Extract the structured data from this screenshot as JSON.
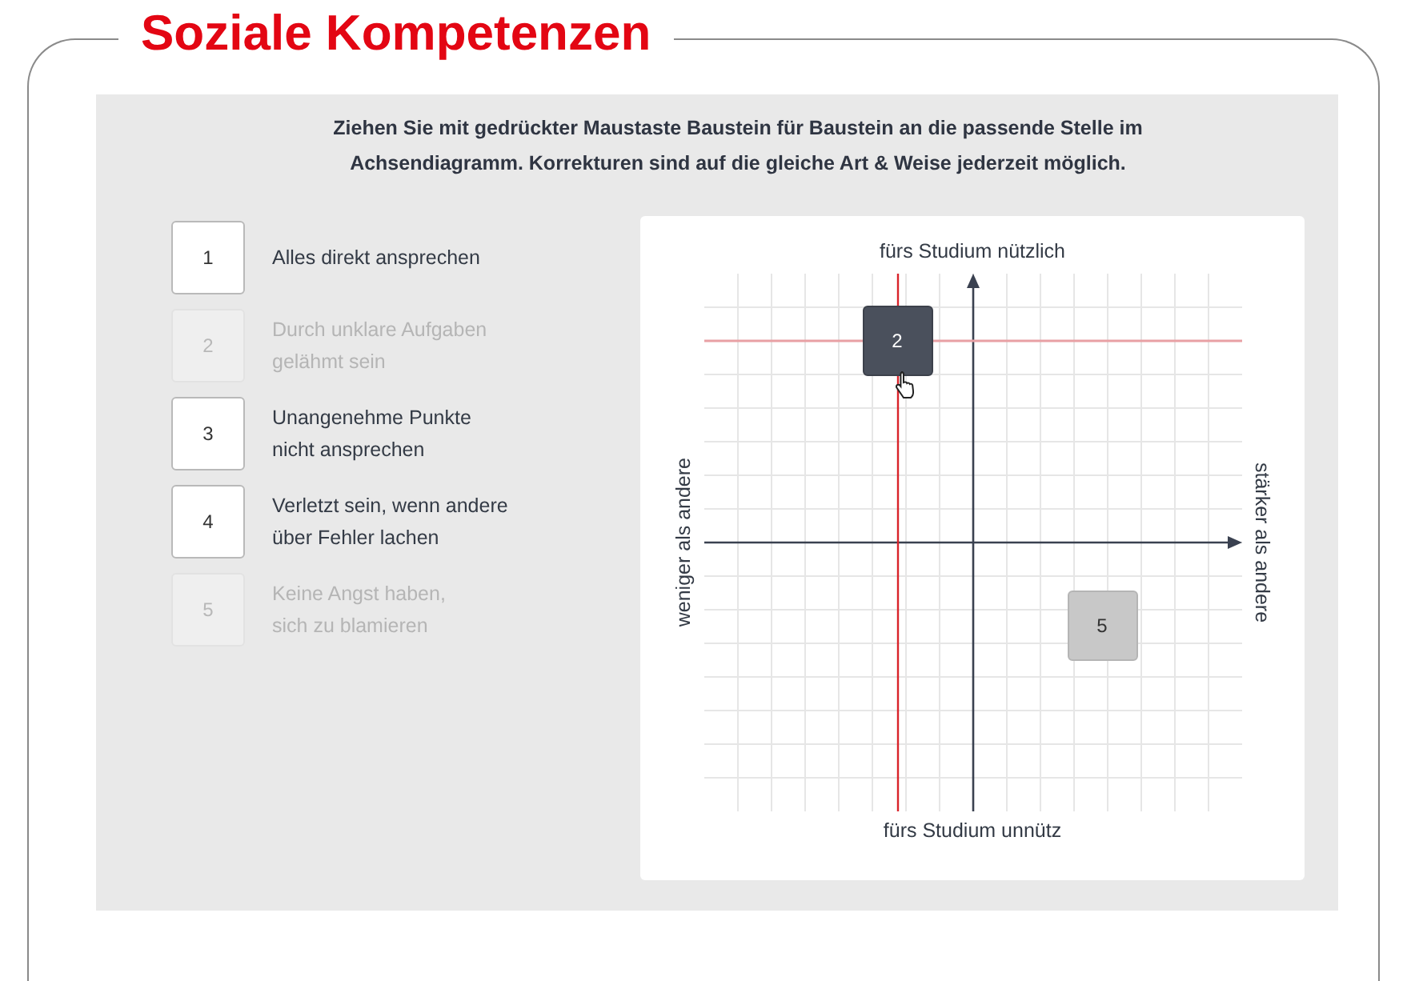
{
  "title": "Soziale Kompetenzen",
  "instruction": "Ziehen Sie mit gedrückter Maustaste Baustein für Baustein an die passende Stelle im Achsendiagramm. Korrekturen sind auf die gleiche Art & Weise jederzeit möglich.",
  "items": [
    {
      "number": "1",
      "label": "Alles direkt ansprechen",
      "placed": false
    },
    {
      "number": "2",
      "label": "Durch unklare Aufgaben\ngelähmt sein",
      "placed": true
    },
    {
      "number": "3",
      "label": "Unangenehme Punkte\nnicht ansprechen",
      "placed": false
    },
    {
      "number": "4",
      "label": "Verletzt sein, wenn andere\nüber Fehler lachen",
      "placed": false
    },
    {
      "number": "5",
      "label": "Keine Angst haben,\nsich zu blamieren",
      "placed": true
    }
  ],
  "diagram": {
    "tiles": [
      {
        "number": "2",
        "dragging": true
      },
      {
        "number": "5",
        "dragging": false
      }
    ],
    "top_label": "fürs Studium nützlich",
    "bottom_label": "fürs Studium unnütz",
    "left_label": "weniger als andere",
    "right_label": "stärker als andere"
  }
}
